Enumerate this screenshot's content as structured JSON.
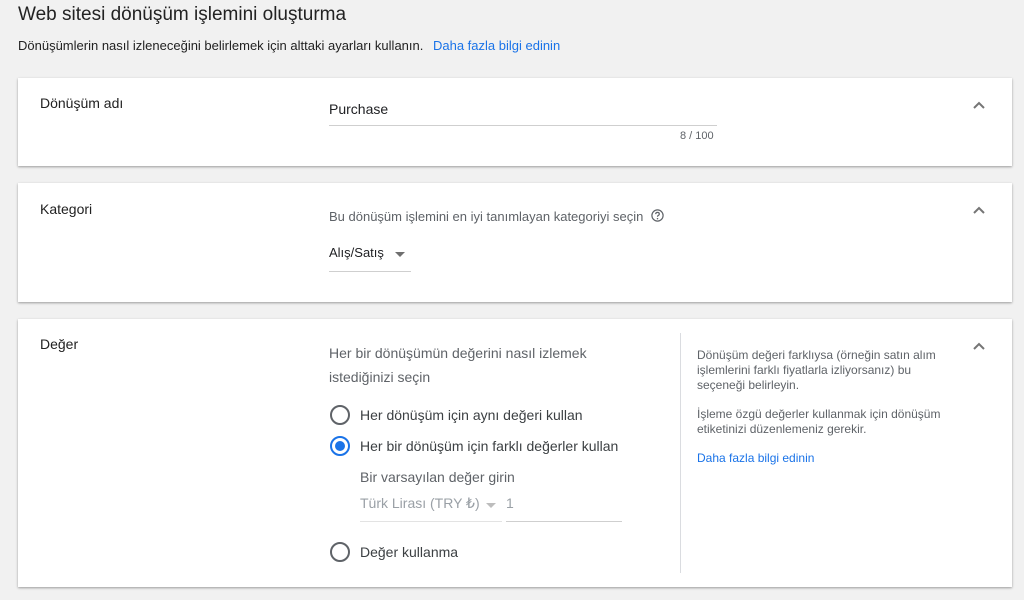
{
  "header": {
    "title": "Web sitesi dönüşüm işlemini oluşturma",
    "subtitle": "Dönüşümlerin nasıl izleneceğini belirlemek için alttaki ayarları kullanın.",
    "learn_more": "Daha fazla bilgi edinin"
  },
  "conversion_name": {
    "label": "Dönüşüm adı",
    "value": "Purchase",
    "char_count": "8 / 100"
  },
  "category": {
    "label": "Kategori",
    "prompt": "Bu dönüşüm işlemini en iyi tanımlayan kategoriyi seçin",
    "selected": "Alış/Satış"
  },
  "value": {
    "label": "Değer",
    "prompt": "Her bir dönüşümün değerini nasıl izlemek istediğinizi seçin",
    "options": [
      {
        "label": "Her dönüşüm için aynı değeri kullan",
        "selected": false
      },
      {
        "label": "Her bir dönüşüm için farklı değerler kullan",
        "selected": true
      },
      {
        "label": "Değer kullanma",
        "selected": false
      }
    ],
    "default_label": "Bir varsayılan değer girin",
    "currency": "Türk Lirası (TRY ₺)",
    "amount": "1",
    "help": {
      "paragraph1": "Dönüşüm değeri farklıysa (örneğin satın alım işlemlerini farklı fiyatlarla izliyorsanız) bu seçeneği belirleyin.",
      "paragraph2": "İşleme özgü değerler kullanmak için dönüşüm etiketinizi düzenlemeniz gerekir.",
      "link": "Daha fazla bilgi edinin"
    }
  },
  "colors": {
    "accent": "#1a73e8",
    "background": "#f1f1f1"
  },
  "icons": [
    "chevron-up-icon",
    "help-circle-icon",
    "dropdown-arrow-icon",
    "radio-icon"
  ]
}
